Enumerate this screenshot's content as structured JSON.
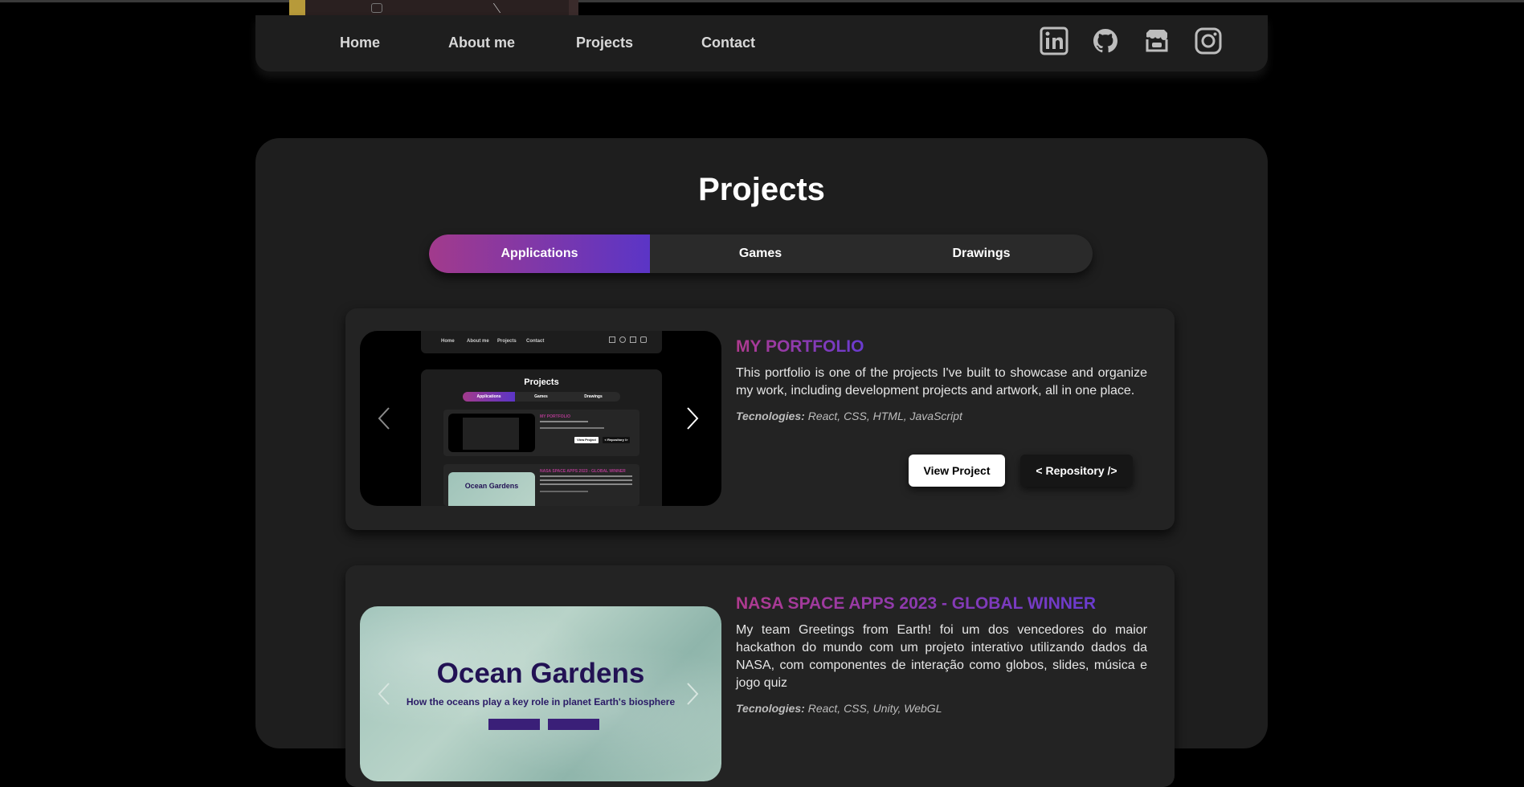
{
  "nav": {
    "links": [
      "Home",
      "About me",
      "Projects",
      "Contact"
    ],
    "social": [
      "linkedin-icon",
      "github-icon",
      "itchio-icon",
      "instagram-icon"
    ]
  },
  "projects": {
    "title": "Projects",
    "tabs": [
      "Applications",
      "Games",
      "Drawings"
    ],
    "active_tab": "Applications",
    "cards": [
      {
        "title": "MY PORTFOLIO",
        "description": "This portfolio is one of the projects I've built to showcase and organize my work, including development projects and artwork, all in one place.",
        "tech_label": "Tecnologies:",
        "tech": "React, CSS, HTML, JavaScript",
        "view_label": "View Project",
        "repo_label": "< Repository />",
        "preview": {
          "nav": [
            "Home",
            "About me",
            "Projects",
            "Contact"
          ],
          "title": "Projects",
          "tabs": [
            "Applications",
            "Games",
            "Drawings"
          ],
          "card1_title": "MY PORTFOLIO",
          "card1_buttons": [
            "View Project",
            "< Repository />"
          ],
          "card2_title": "NASA SPACE APPS 2023 - GLOBAL WINNER",
          "card2_image_title": "Ocean Gardens"
        }
      },
      {
        "title": "NASA SPACE APPS 2023 - GLOBAL WINNER",
        "description": "My team Greetings from Earth! foi um dos vencedores do maior hackathon do mundo com um projeto interativo utilizando dados da NASA, com componentes de interação como globos, slides, música e jogo quiz",
        "tech_label": "Tecnologies:",
        "tech": "React, CSS, Unity, WebGL",
        "image_title": "Ocean Gardens",
        "image_subtitle": "How the oceans play a key role in planet Earth's biosphere"
      }
    ]
  },
  "colors": {
    "gradient_start": "#a23a8c",
    "gradient_end": "#5b35c6",
    "panel": "#1e1e1e",
    "card": "#232323"
  }
}
